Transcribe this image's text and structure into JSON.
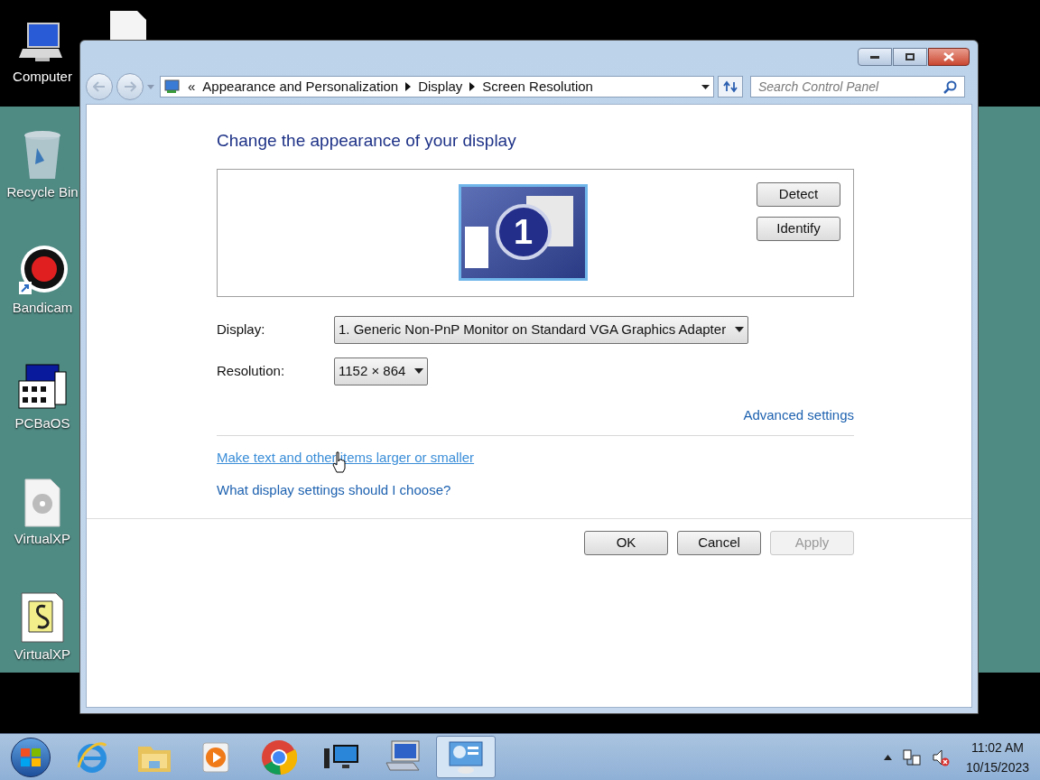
{
  "desktop_icons": [
    {
      "label": "Computer",
      "kind": "computer"
    },
    {
      "label": "Recycle Bin",
      "kind": "bin"
    },
    {
      "label": "Bandicam",
      "kind": "record"
    },
    {
      "label": "PCBaOS",
      "kind": "dos"
    },
    {
      "label": "VirtualXP",
      "kind": "disc"
    },
    {
      "label": "VirtualXP",
      "kind": "script"
    }
  ],
  "window": {
    "breadcrumb_prefix": "«",
    "breadcrumb": [
      "Appearance and Personalization",
      "Display",
      "Screen Resolution"
    ],
    "search": {
      "placeholder": "Search Control Panel"
    },
    "heading": "Change the appearance of your display",
    "monitor_number": "1",
    "side_buttons": [
      "Detect",
      "Identify"
    ],
    "fields": [
      {
        "label": "Display:",
        "value": "1. Generic Non-PnP Monitor on Standard VGA Graphics Adapter"
      },
      {
        "label": "Resolution:",
        "value": "1152 × 864"
      }
    ],
    "advanced_link": "Advanced settings",
    "links": [
      {
        "text": "Make text and other items larger or smaller",
        "hovered": true
      },
      {
        "text": "What display settings should I choose?",
        "hovered": false
      }
    ],
    "buttons": [
      {
        "label": "OK",
        "disabled": false
      },
      {
        "label": "Cancel",
        "disabled": false
      },
      {
        "label": "Apply",
        "disabled": true
      }
    ]
  },
  "taskbar": {
    "apps": [
      {
        "kind": "ie",
        "selected": false
      },
      {
        "kind": "folder",
        "selected": false
      },
      {
        "kind": "media",
        "selected": false
      },
      {
        "kind": "chrome",
        "selected": false
      },
      {
        "kind": "monitor",
        "selected": false
      },
      {
        "kind": "network",
        "selected": false
      },
      {
        "kind": "display",
        "selected": true
      }
    ],
    "time": "11:02 AM",
    "date": "10/15/2023"
  }
}
